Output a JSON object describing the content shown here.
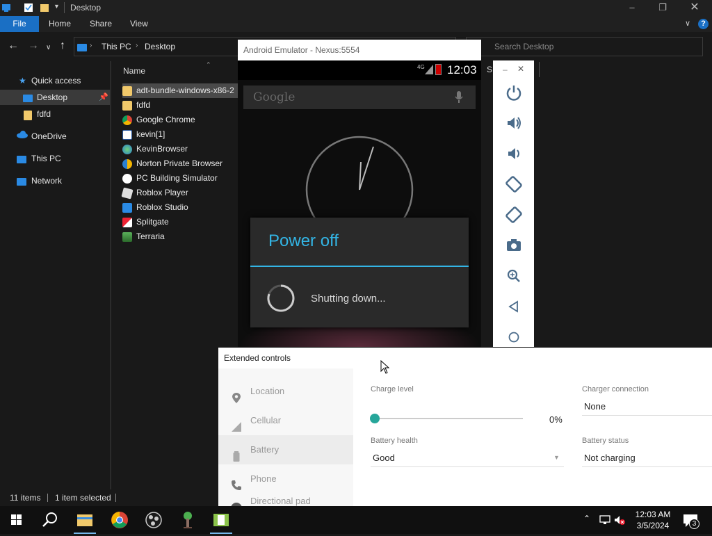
{
  "explorer": {
    "title": "Desktop",
    "ribbon_tabs": [
      "File",
      "Home",
      "Share",
      "View"
    ],
    "address": {
      "this_pc": "This PC",
      "desktop": "Desktop"
    },
    "search_placeholder": "Search Desktop",
    "column_name": "Name",
    "nav": [
      "Quick access",
      "Desktop",
      "fdfd",
      "OneDrive",
      "This PC",
      "Network"
    ],
    "files": [
      "adt-bundle-windows-x86-2",
      "fdfd",
      "Google Chrome",
      "kevin[1]",
      "KevinBrowser",
      "Norton Private Browser",
      "PC Building Simulator",
      "Roblox Player",
      "Roblox Studio",
      "Splitgate",
      "Terraria"
    ],
    "status": {
      "count": "11 items",
      "selected": "1 item selected"
    },
    "partial_label": "S"
  },
  "emulator": {
    "title": "Android Emulator - Nexus:5554",
    "time": "12:03",
    "network": "4G",
    "search_brand": "Google",
    "dialog_title": "Power off",
    "dialog_message": "Shutting down..."
  },
  "extended": {
    "title": "Extended controls",
    "nav": [
      "Location",
      "Cellular",
      "Battery",
      "Phone",
      "Directional pad"
    ],
    "charge_label": "Charge level",
    "charge_value": "0%",
    "charge_fraction": 0,
    "charger_label": "Charger connection",
    "charger_value": "None",
    "health_label": "Battery health",
    "health_value": "Good",
    "status_label": "Battery status",
    "status_value": "Not charging"
  },
  "taskbar": {
    "time": "12:03 AM",
    "date": "3/5/2024",
    "notifications": "3"
  },
  "colors": {
    "accent_blue": "#1a6fc4",
    "android_blue": "#33b5e5",
    "slider_teal": "#26a69a"
  }
}
